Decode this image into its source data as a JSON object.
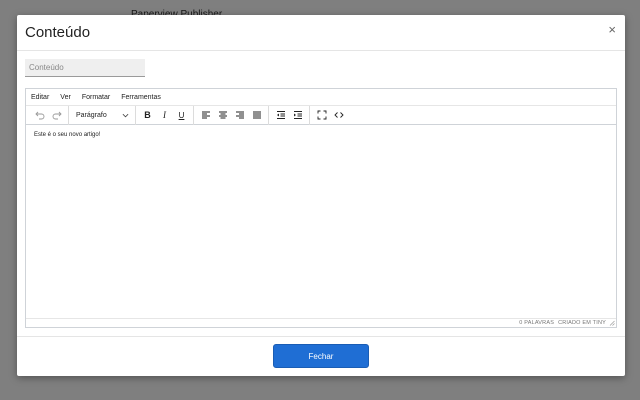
{
  "background": {
    "title": "Paperview Publisher"
  },
  "modal": {
    "title": "Conteúdo",
    "close_symbol": "×",
    "title_input": {
      "placeholder": "Conteúdo",
      "value": ""
    },
    "footer": {
      "close_label": "Fechar"
    }
  },
  "editor": {
    "menubar": [
      "Editar",
      "Ver",
      "Formatar",
      "Ferramentas"
    ],
    "toolbar": {
      "block_format": "Parágrafo",
      "bold": "B",
      "italic": "I",
      "underline": "U"
    },
    "content": "Este é o seu novo artigo!",
    "status": {
      "words": "0 PALAVRAS",
      "powered_by": "CRIADO EM TINY"
    }
  },
  "colors": {
    "primary_button": "#1f6ed4",
    "overlay": "rgba(0,0,0,0.5)"
  }
}
